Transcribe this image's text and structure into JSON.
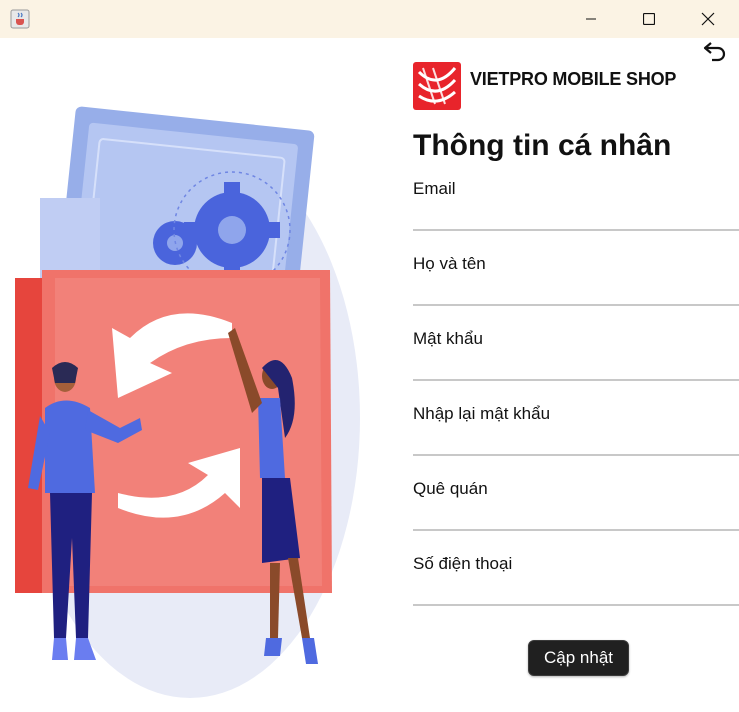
{
  "window": {
    "icons": {
      "app": "java-cup-icon",
      "minimize": "minimize-icon",
      "maximize": "maximize-icon",
      "close": "close-icon"
    }
  },
  "header": {
    "brand": "VIETPRO MOBILE SHOP",
    "back_icon": "undo-arrow-icon"
  },
  "form": {
    "title": "Thông tin cá nhân",
    "fields": [
      {
        "label": "Email",
        "value": ""
      },
      {
        "label": "Họ và tên",
        "value": ""
      },
      {
        "label": "Mật khẩu",
        "value": ""
      },
      {
        "label": "Nhập lại mật khẩu",
        "value": ""
      },
      {
        "label": "Quê quán",
        "value": ""
      },
      {
        "label": "Số điện thoại",
        "value": ""
      }
    ],
    "submit_label": "Cập nhật"
  },
  "colors": {
    "brand_red": "#e8242b",
    "folder_coral": "#f0736a",
    "title_bar": "#fbf3e4",
    "button_dark": "#202020"
  }
}
